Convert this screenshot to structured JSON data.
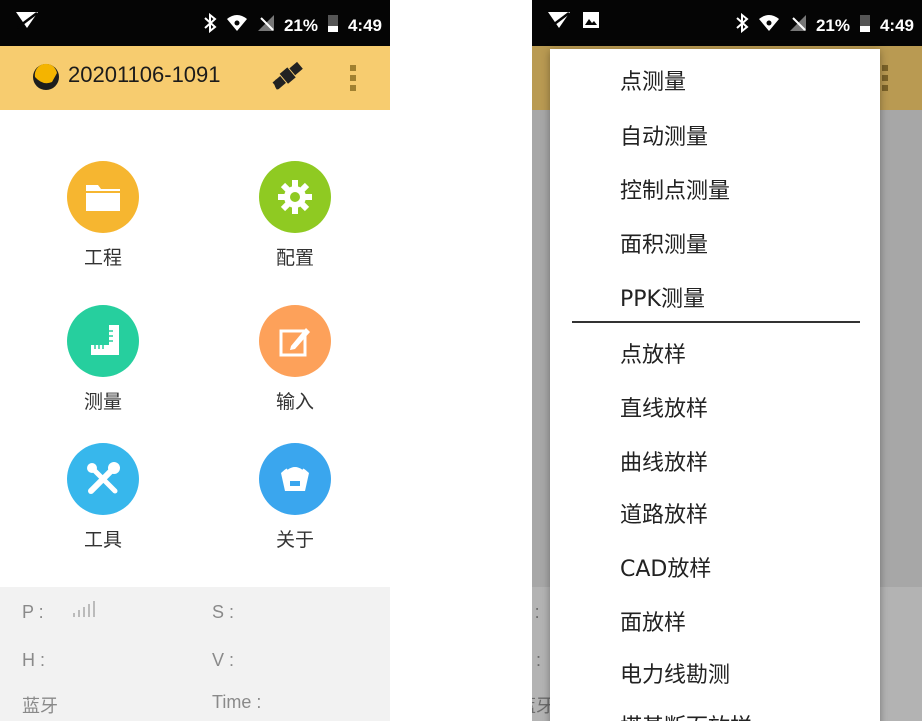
{
  "status": {
    "battery_pct": "21%",
    "time": "4:49"
  },
  "appbar": {
    "title": "20201106-1091"
  },
  "grid": [
    {
      "label": "工程",
      "color": "#f6b630",
      "icon": "folder-icon"
    },
    {
      "label": "配置",
      "color": "#8fca22",
      "icon": "gear-icon"
    },
    {
      "label": "测量",
      "color": "#26cf9e",
      "icon": "ruler-icon"
    },
    {
      "label": "输入",
      "color": "#fda15a",
      "icon": "edit-icon"
    },
    {
      "label": "工具",
      "color": "#37b7ec",
      "icon": "tools-icon"
    },
    {
      "label": "关于",
      "color": "#3aa6ee",
      "icon": "receiver-icon"
    }
  ],
  "info": {
    "p": "P :",
    "s": "S :",
    "h": "H :",
    "v": "V :",
    "bt": "蓝牙",
    "time": "Time :"
  },
  "info_right": {
    "p": "P :",
    "h": "H :",
    "bt": "蓝牙"
  },
  "menu": {
    "group1": [
      "点测量",
      "自动测量",
      "控制点测量",
      "面积测量",
      "PPK测量"
    ],
    "group2": [
      "点放样",
      "直线放样",
      "曲线放样",
      "道路放样",
      "CAD放样",
      "面放样",
      "电力线勘测",
      "塔基断面放样"
    ]
  }
}
